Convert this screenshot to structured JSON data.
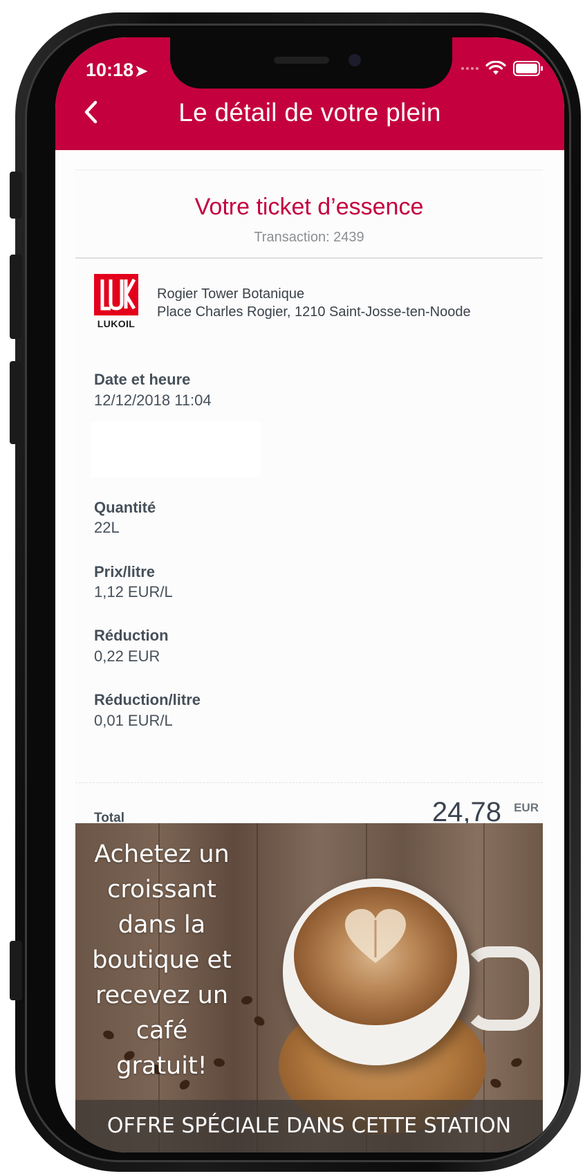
{
  "status_bar": {
    "time": "10:18",
    "location_icon": "location-arrow-icon",
    "wifi_icon": "wifi-icon",
    "battery_icon": "battery-icon"
  },
  "header": {
    "title": "Le détail de votre plein",
    "back_icon": "chevron-left-icon",
    "color": "#c4003e"
  },
  "ticket": {
    "title": "Votre ticket d’essence",
    "transaction": "Transaction: 2439",
    "station": {
      "brand_logo_text": "LUKOIL",
      "name": "Rogier Tower Botanique",
      "address": "Place Charles Rogier, 1210 Saint-Josse-ten-Noode"
    },
    "fields": {
      "datetime": {
        "label": "Date et heure",
        "value": "12/12/2018 11:04"
      },
      "quantity": {
        "label": "Quantité",
        "value": "22L"
      },
      "price_per_litre": {
        "label": "Prix/litre",
        "value": "1,12 EUR/L"
      },
      "discount": {
        "label": "Réduction",
        "value": "0,22 EUR"
      },
      "discount_per_litre": {
        "label": "Réduction/litre",
        "value": "0,01 EUR/L"
      }
    },
    "total": {
      "label": "Total",
      "value": "24,78",
      "currency": "EUR"
    }
  },
  "promo": {
    "text": "Achetez un\ncroissant\ndans la\nboutique et\nrecevez un\ncafé gratuit!",
    "banner": "OFFRE SPÉCIALE DANS CETTE STATION",
    "image": "coffee-cup-image"
  }
}
